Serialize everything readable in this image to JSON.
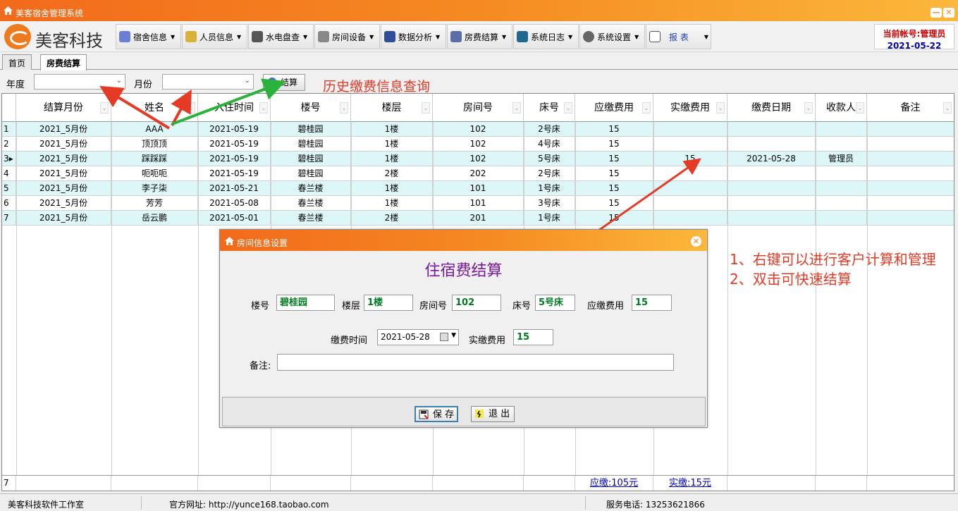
{
  "window": {
    "title": "美客宿舍管理系统",
    "brand": "美客科技",
    "colors": {
      "title_bar_start": "#f26a1b",
      "title_bar_end": "#fbb83a",
      "accent_red": "#e53a26",
      "row_alt": "#ddf6f8"
    }
  },
  "toolbar": {
    "menus": [
      {
        "label": "宿舍信息",
        "icon": "flask-icon"
      },
      {
        "label": "人员信息",
        "icon": "people-icon"
      },
      {
        "label": "水电盘查",
        "icon": "faucet-icon"
      },
      {
        "label": "房间设备",
        "icon": "printer-icon"
      },
      {
        "label": "数据分析",
        "icon": "chart-icon"
      },
      {
        "label": "房费结算",
        "icon": "calculator-icon"
      },
      {
        "label": "系统日志",
        "icon": "log-icon"
      },
      {
        "label": "系统设置",
        "icon": "gear-icon"
      },
      {
        "label": "报 表",
        "icon": "report-icon"
      }
    ],
    "account_label": "当前帐号:管理员",
    "date": "2021-05-22"
  },
  "tabs": [
    {
      "label": "首页"
    },
    {
      "label": "房费结算"
    }
  ],
  "filter": {
    "year_label": "年度",
    "year_value": "",
    "month_label": "月份",
    "month_value": "",
    "calc_button": "结算",
    "history_note": "历史缴费信息查询"
  },
  "grid": {
    "columns": [
      "结算月份",
      "姓名",
      "入住时间",
      "楼号",
      "楼层",
      "房间号",
      "床号",
      "应缴费用",
      "实缴费用",
      "缴费日期",
      "收款人",
      "备注"
    ],
    "rows": [
      {
        "num": "1",
        "cells": [
          "2021_5月份",
          "AAA",
          "2021-05-19",
          "碧桂园",
          "1楼",
          "102",
          "2号床",
          "15",
          "",
          "",
          "",
          ""
        ]
      },
      {
        "num": "2",
        "cells": [
          "2021_5月份",
          "顶顶顶",
          "2021-05-19",
          "碧桂园",
          "1楼",
          "102",
          "4号床",
          "15",
          "",
          "",
          "",
          ""
        ]
      },
      {
        "num": "3▸",
        "cells": [
          "2021_5月份",
          "踩踩踩",
          "2021-05-19",
          "碧桂园",
          "1楼",
          "102",
          "5号床",
          "15",
          "15",
          "2021-05-28",
          "管理员",
          ""
        ]
      },
      {
        "num": "4",
        "cells": [
          "2021_5月份",
          "呃呃呃",
          "2021-05-19",
          "碧桂园",
          "2楼",
          "202",
          "2号床",
          "15",
          "",
          "",
          "",
          ""
        ]
      },
      {
        "num": "5",
        "cells": [
          "2021_5月份",
          "李子柒",
          "2021-05-21",
          "春兰楼",
          "1楼",
          "101",
          "1号床",
          "15",
          "",
          "",
          "",
          ""
        ]
      },
      {
        "num": "6",
        "cells": [
          "2021_5月份",
          "芳芳",
          "2021-05-08",
          "春兰楼",
          "1楼",
          "101",
          "3号床",
          "15",
          "",
          "",
          "",
          ""
        ]
      },
      {
        "num": "7",
        "cells": [
          "2021_5月份",
          "岳云鹏",
          "2021-05-01",
          "春兰楼",
          "2楼",
          "201",
          "1号床",
          "15",
          "",
          "",
          "",
          ""
        ]
      }
    ],
    "footer": {
      "count": "7",
      "due_total": "应缴:105元",
      "paid_total": "实缴:15元"
    }
  },
  "annotations": {
    "tip1": "1、右键可以进行客户计算和管理",
    "tip2": "2、双击可快速结算"
  },
  "dialog": {
    "title": "房间信息设置",
    "heading": "住宿费结算",
    "building_label": "楼号",
    "building_value": "碧桂园",
    "floor_label": "楼层",
    "floor_value": "1楼",
    "room_label": "房间号",
    "room_value": "102",
    "bed_label": "床号",
    "bed_value": "5号床",
    "due_label": "应缴费用",
    "due_value": "15",
    "paytime_label": "缴费时间",
    "paytime_value": "2021-05-28",
    "paid_label": "实缴费用",
    "paid_value": "15",
    "note_label": "备注:",
    "note_value": "",
    "save_button": "保 存",
    "exit_button": "退 出"
  },
  "status": {
    "studio": "美客科技软件工作室",
    "website": "官方网址:  http://yunce168.taobao.com",
    "phone": "服务电话:  13253621866"
  }
}
